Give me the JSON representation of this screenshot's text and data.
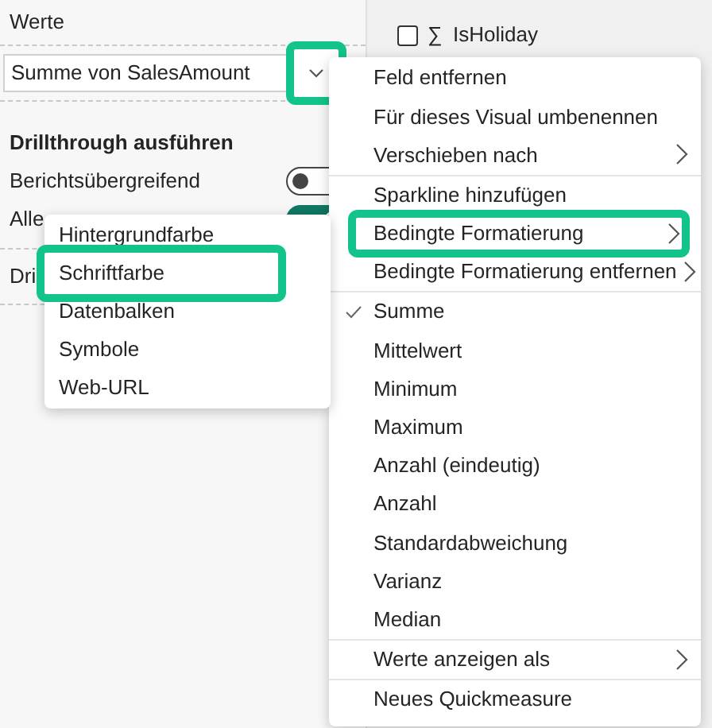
{
  "fields_list": [
    {
      "name": "IsHoliday",
      "checked": false,
      "symbol": "∑"
    }
  ],
  "left_panel": {
    "section_title": "Werte",
    "value_field": {
      "value": "Summe von SalesAmount",
      "highlighted": true
    },
    "drillthrough_title": "Drillthrough ausführen",
    "toggles": [
      {
        "label": "Berichtsübergreifend",
        "on": false
      },
      {
        "label": "Alle",
        "on": true
      }
    ],
    "button_label": "Dri"
  },
  "context_menu": {
    "items": [
      {
        "kind": "item",
        "label": "Feld entfernen",
        "submenu": false,
        "checked": false,
        "highlighted": false
      },
      {
        "kind": "item",
        "label": "Für dieses Visual umbenennen",
        "submenu": false,
        "checked": false,
        "highlighted": false
      },
      {
        "kind": "item",
        "label": "Verschieben nach",
        "submenu": true,
        "checked": false,
        "highlighted": false
      },
      {
        "kind": "divider"
      },
      {
        "kind": "item",
        "label": "Sparkline hinzufügen",
        "submenu": false,
        "checked": false,
        "highlighted": false
      },
      {
        "kind": "item",
        "label": "Bedingte Formatierung",
        "submenu": true,
        "checked": false,
        "highlighted": true
      },
      {
        "kind": "item",
        "label": "Bedingte Formatierung entfernen",
        "submenu": true,
        "checked": false,
        "highlighted": false
      },
      {
        "kind": "divider"
      },
      {
        "kind": "item",
        "label": "Summe",
        "submenu": false,
        "checked": true,
        "highlighted": false
      },
      {
        "kind": "item",
        "label": "Mittelwert",
        "submenu": false,
        "checked": false,
        "highlighted": false
      },
      {
        "kind": "item",
        "label": "Minimum",
        "submenu": false,
        "checked": false,
        "highlighted": false
      },
      {
        "kind": "item",
        "label": "Maximum",
        "submenu": false,
        "checked": false,
        "highlighted": false
      },
      {
        "kind": "item",
        "label": "Anzahl (eindeutig)",
        "submenu": false,
        "checked": false,
        "highlighted": false
      },
      {
        "kind": "item",
        "label": "Anzahl",
        "submenu": false,
        "checked": false,
        "highlighted": false
      },
      {
        "kind": "item",
        "label": "Standardabweichung",
        "submenu": false,
        "checked": false,
        "highlighted": false
      },
      {
        "kind": "item",
        "label": "Varianz",
        "submenu": false,
        "checked": false,
        "highlighted": false
      },
      {
        "kind": "item",
        "label": "Median",
        "submenu": false,
        "checked": false,
        "highlighted": false
      },
      {
        "kind": "divider"
      },
      {
        "kind": "item",
        "label": "Werte anzeigen als",
        "submenu": true,
        "checked": false,
        "highlighted": false
      },
      {
        "kind": "divider"
      },
      {
        "kind": "item",
        "label": "Neues Quickmeasure",
        "submenu": false,
        "checked": false,
        "highlighted": false
      }
    ]
  },
  "submenu": {
    "items": [
      {
        "label": "Hintergrundfarbe",
        "highlighted": false
      },
      {
        "label": "Schriftfarbe",
        "highlighted": true
      },
      {
        "label": "Datenbalken",
        "highlighted": false
      },
      {
        "label": "Symbole",
        "highlighted": false
      },
      {
        "label": "Web-URL",
        "highlighted": false
      }
    ]
  }
}
